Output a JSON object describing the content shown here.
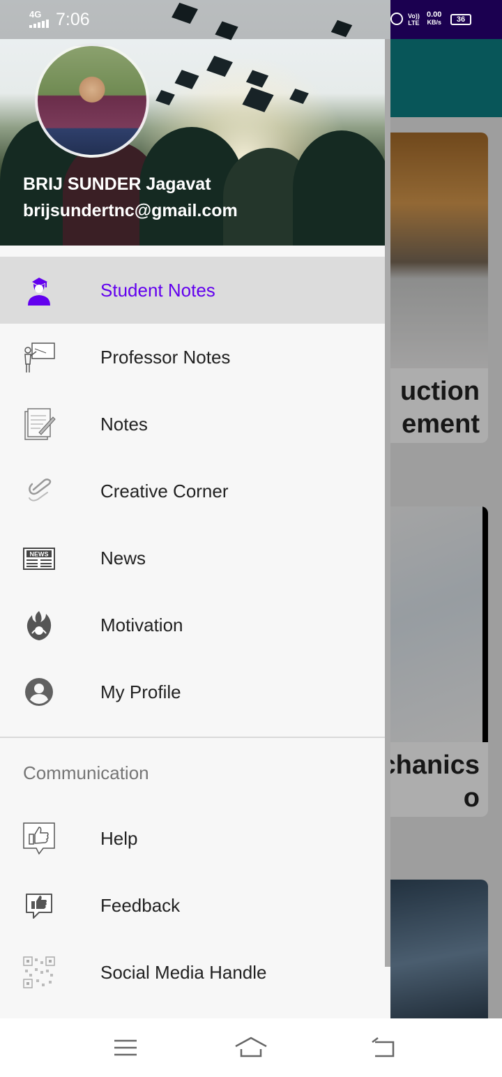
{
  "status_bar": {
    "time": "7:06",
    "signal": "4G",
    "volte_line1": "Vo))",
    "volte_line2": "LTE",
    "speed_value": "0.00",
    "speed_unit": "KB/s",
    "battery": "36"
  },
  "background": {
    "card1_title_line1": "uction",
    "card1_title_line2": "ement",
    "card2_title_line1": "chanics",
    "card2_title_line2": "o"
  },
  "drawer": {
    "user_name": "BRIJ SUNDER Jagavat",
    "user_email": "brijsundertnc@gmail.com",
    "items": [
      {
        "label": "Student Notes",
        "icon": "student-icon",
        "active": true
      },
      {
        "label": "Professor Notes",
        "icon": "professor-board-icon"
      },
      {
        "label": "Notes",
        "icon": "notepad-icon"
      },
      {
        "label": "Creative Corner",
        "icon": "paperclip-icon"
      },
      {
        "label": "News",
        "icon": "newspaper-icon"
      },
      {
        "label": "Motivation",
        "icon": "fire-icon"
      },
      {
        "label": "My Profile",
        "icon": "account-circle-icon"
      }
    ],
    "section_title": "Communication",
    "comm_items": [
      {
        "label": "Help",
        "icon": "thumbs-up-bubble-icon"
      },
      {
        "label": "Feedback",
        "icon": "feedback-thumb-icon"
      },
      {
        "label": "Social Media Handle",
        "icon": "qr-code-icon"
      }
    ],
    "active_color": "#6200ee"
  },
  "navigation_bar": {
    "buttons": [
      "menu-icon",
      "home-icon",
      "back-icon"
    ]
  }
}
